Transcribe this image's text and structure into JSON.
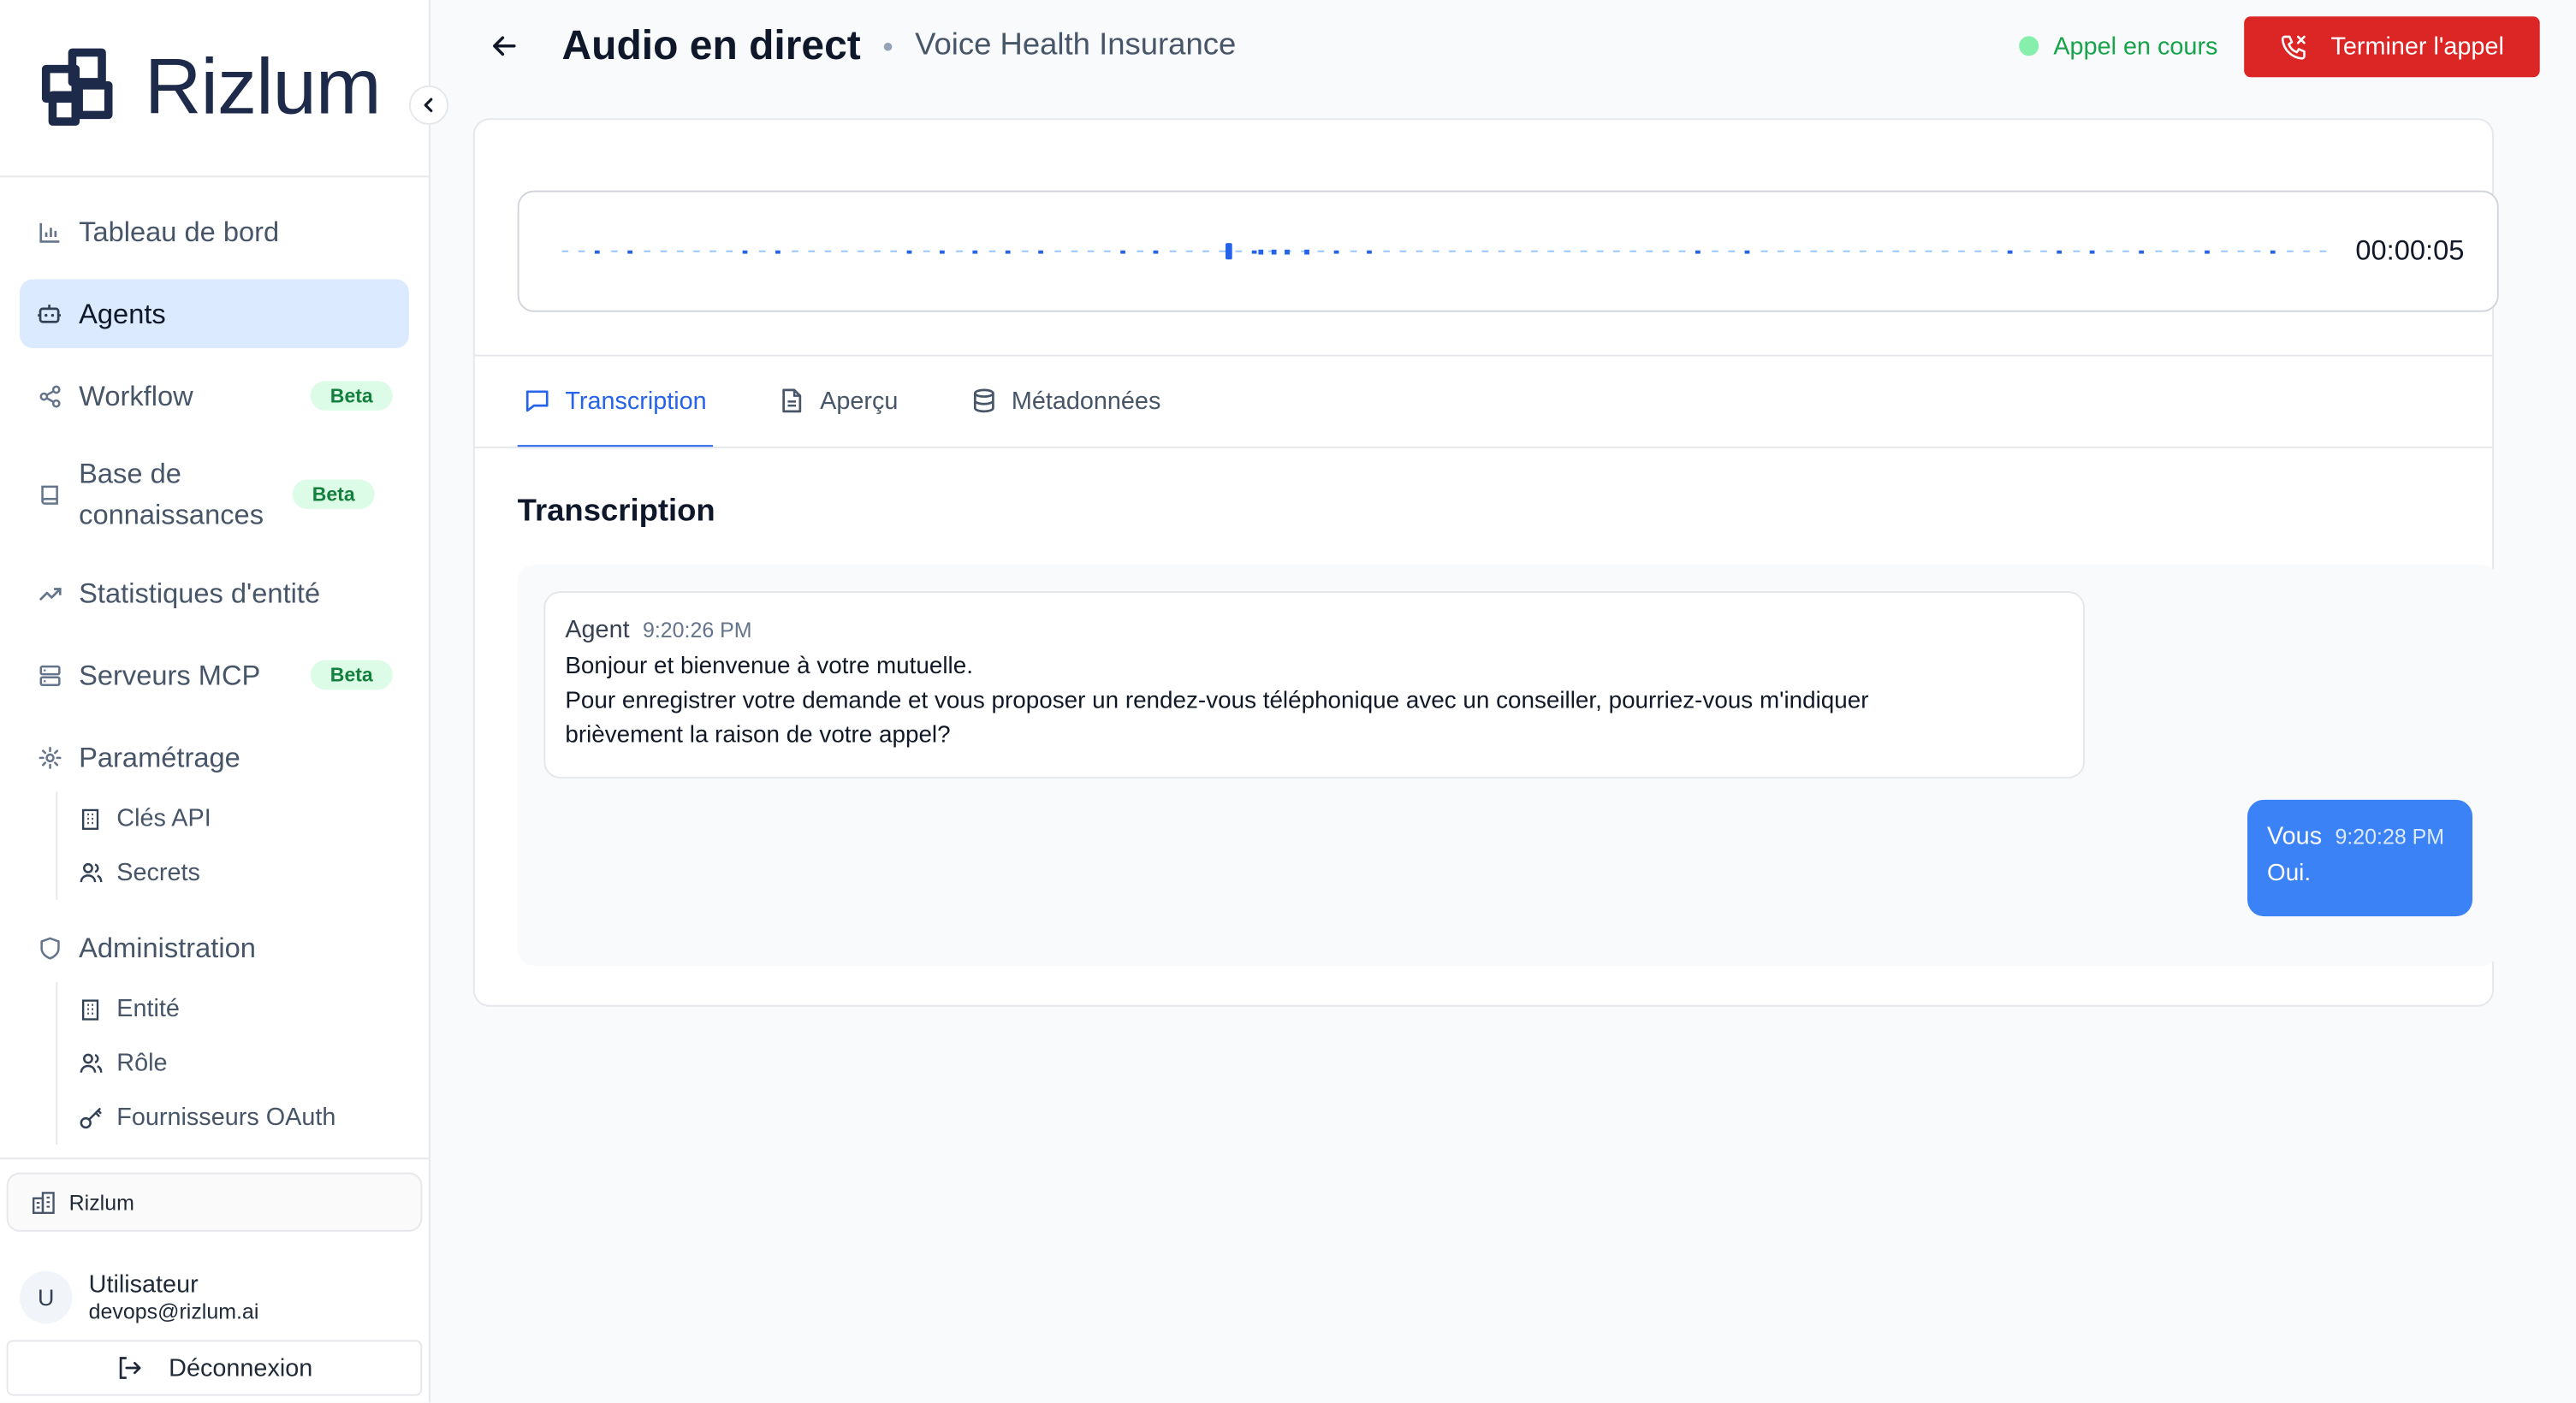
{
  "app": {
    "brand": "Rizlum"
  },
  "sidebar": {
    "items": [
      {
        "label": "Tableau de bord",
        "icon": "bar-chart-icon"
      },
      {
        "label": "Agents",
        "icon": "bot-icon",
        "active": true
      },
      {
        "label": "Workflow",
        "icon": "share-icon",
        "badge": "Beta"
      },
      {
        "label": "Base de connaissances",
        "icon": "book-icon",
        "badge": "Beta"
      },
      {
        "label": "Statistiques d'entité",
        "icon": "trending-up-icon"
      },
      {
        "label": "Serveurs MCP",
        "icon": "server-icon",
        "badge": "Beta"
      },
      {
        "label": "Paramétrage",
        "icon": "gear-icon"
      },
      {
        "label": "Administration",
        "icon": "shield-icon"
      }
    ],
    "settings_sub": [
      {
        "label": "Clés API",
        "icon": "building-icon"
      },
      {
        "label": "Secrets",
        "icon": "users-icon"
      }
    ],
    "admin_sub": [
      {
        "label": "Entité",
        "icon": "building-icon"
      },
      {
        "label": "Rôle",
        "icon": "users-icon"
      },
      {
        "label": "Fournisseurs OAuth",
        "icon": "key-icon"
      }
    ],
    "org": "Rizlum",
    "user": {
      "initial": "U",
      "name": "Utilisateur",
      "email": "devops@rizlum.ai"
    },
    "logout_label": "Déconnexion"
  },
  "header": {
    "title": "Audio en direct",
    "subtitle": "Voice Health Insurance",
    "status": "Appel en cours",
    "end_call_label": "Terminer l'appel"
  },
  "player": {
    "timer": "00:00:05"
  },
  "tabs": [
    {
      "label": "Transcription",
      "icon": "message-icon",
      "active": true
    },
    {
      "label": "Aperçu",
      "icon": "file-icon"
    },
    {
      "label": "Métadonnées",
      "icon": "database-icon"
    }
  ],
  "transcript": {
    "title": "Transcription",
    "messages": [
      {
        "sender": "Agent",
        "time": "9:20:26 PM",
        "line1": "Bonjour et bienvenue à votre mutuelle.",
        "line2": "Pour enregistrer votre demande et vous proposer un rendez-vous téléphonique avec un conseiller, pourriez-vous m'indiquer",
        "line3": "brièvement la raison de votre appel?"
      },
      {
        "sender": "Vous",
        "time": "9:20:28 PM",
        "text": "Oui."
      }
    ]
  },
  "colors": {
    "accent": "#2563eb",
    "active_nav": "#dbeafe",
    "danger": "#dc2626",
    "success": "#16a34a",
    "user_bubble": "#3b82f6"
  }
}
